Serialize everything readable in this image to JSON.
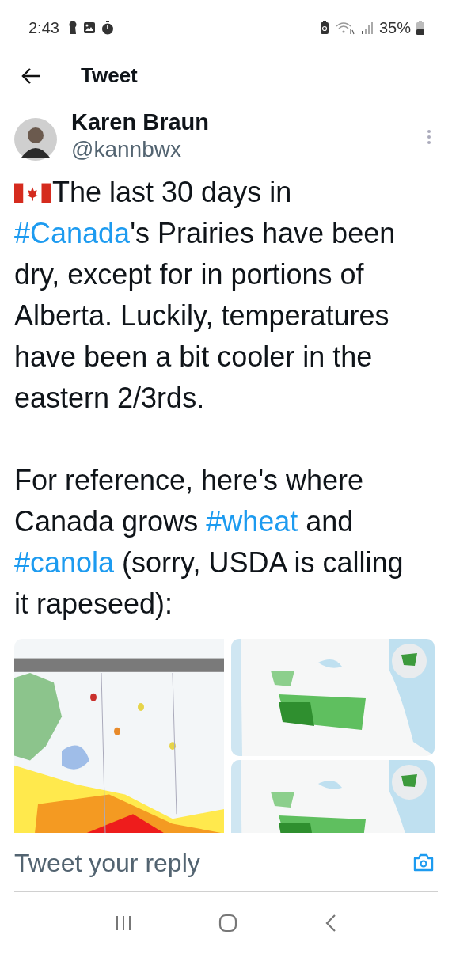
{
  "status_bar": {
    "time": "2:43",
    "battery": "35%"
  },
  "header": {
    "title": "Tweet"
  },
  "tweet": {
    "author": {
      "name": "Karen Braun",
      "handle": "@kannbwx"
    },
    "paragraphs": [
      [
        {
          "kind": "flag"
        },
        {
          "kind": "text",
          "text": "The last 30 days in "
        },
        {
          "kind": "hashtag",
          "text": "#Canada"
        },
        {
          "kind": "text",
          "text": "'s Prairies have been dry, except for in portions of Alberta. Luckily, temperatures have been a bit cooler in the eastern 2/3rds."
        }
      ],
      [
        {
          "kind": "text",
          "text": "For reference, here's where Canada grows "
        },
        {
          "kind": "hashtag",
          "text": "#wheat"
        },
        {
          "kind": "text",
          "text": " and "
        },
        {
          "kind": "hashtag",
          "text": "#canola"
        },
        {
          "kind": "text",
          "text": " (sorry, USDA is calling it rapeseed):"
        }
      ]
    ],
    "media": [
      {
        "kind": "picture"
      },
      {
        "kind": "picture"
      },
      {
        "kind": "picture"
      }
    ]
  },
  "reply": {
    "placeholder": "Tweet your reply"
  }
}
